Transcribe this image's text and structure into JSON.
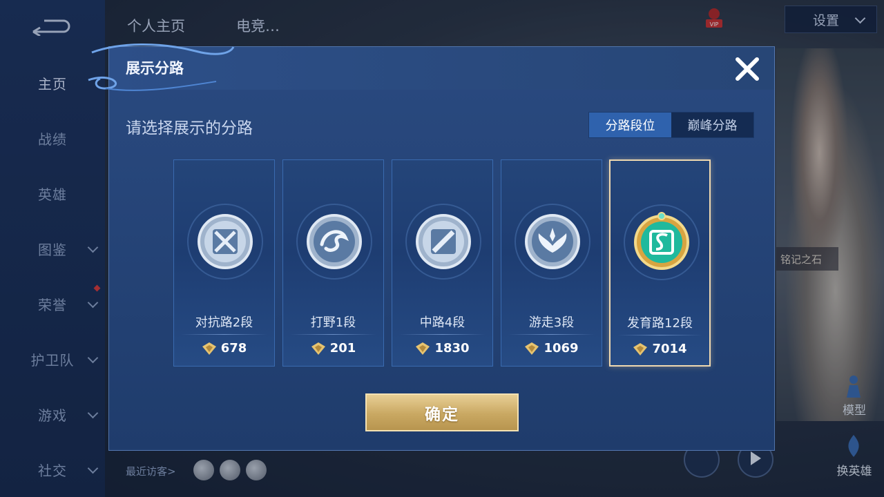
{
  "sidebar": {
    "items": [
      {
        "label": "主页",
        "has_chevron": false,
        "active": true
      },
      {
        "label": "战绩",
        "has_chevron": false
      },
      {
        "label": "英雄",
        "has_chevron": false
      },
      {
        "label": "图鉴",
        "has_chevron": true
      },
      {
        "label": "荣誉",
        "has_chevron": true,
        "has_dot": true
      },
      {
        "label": "护卫队",
        "has_chevron": true
      },
      {
        "label": "游戏",
        "has_chevron": true
      },
      {
        "label": "社交",
        "has_chevron": true
      }
    ]
  },
  "top_tabs": [
    "个人主页",
    "电竞… "
  ],
  "settings_label": "设置",
  "stone_tag": "铭记之石",
  "right_labels": {
    "model": "模型",
    "change_hero": "换英雄"
  },
  "visitors_label": "最近访客>",
  "modal": {
    "title": "展示分路",
    "prompt": "请选择展示的分路",
    "segments": [
      {
        "label": "分路段位",
        "active": true
      },
      {
        "label": "巅峰分路",
        "active": false
      }
    ],
    "lanes": [
      {
        "name": "对抗路2段",
        "score": "678",
        "icon": "clash-lane-icon",
        "selected": false
      },
      {
        "name": "打野1段",
        "score": "201",
        "icon": "jungle-dragon-icon",
        "selected": false
      },
      {
        "name": "中路4段",
        "score": "1830",
        "icon": "mid-lane-icon",
        "selected": false
      },
      {
        "name": "游走3段",
        "score": "1069",
        "icon": "roam-wings-icon",
        "selected": false
      },
      {
        "name": "发育路12段",
        "score": "7014",
        "icon": "farm-lane-icon",
        "selected": true
      }
    ],
    "confirm_label": "确定"
  },
  "colors": {
    "modal_bg": "#234579",
    "segment_active": "#2f62ad",
    "confirm_gold": "#d4b675",
    "selected_border": "#f0d9b0"
  }
}
